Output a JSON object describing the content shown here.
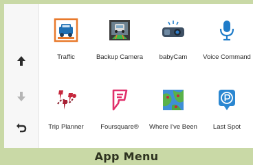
{
  "nav": {
    "up_icon": "arrow-up-icon",
    "down_icon": "arrow-down-icon",
    "back_icon": "back-arrow-icon"
  },
  "apps": [
    {
      "label": "Traffic",
      "icon": "traffic-icon"
    },
    {
      "label": "Backup Camera",
      "icon": "backup-camera-icon"
    },
    {
      "label": "babyCam",
      "icon": "babycam-icon"
    },
    {
      "label": "Voice Command",
      "icon": "microphone-icon"
    },
    {
      "label": "Trip Planner",
      "icon": "trip-planner-icon"
    },
    {
      "label": "Foursquare®",
      "icon": "foursquare-icon"
    },
    {
      "label": "Where I've Been",
      "icon": "where-ive-been-icon"
    },
    {
      "label": "Last Spot",
      "icon": "last-spot-icon"
    }
  ],
  "caption": "App Menu",
  "colors": {
    "frame": "#c9d9a6",
    "accent_orange": "#e8792b",
    "accent_blue": "#1f7cc9",
    "accent_magenta": "#e0306b"
  }
}
